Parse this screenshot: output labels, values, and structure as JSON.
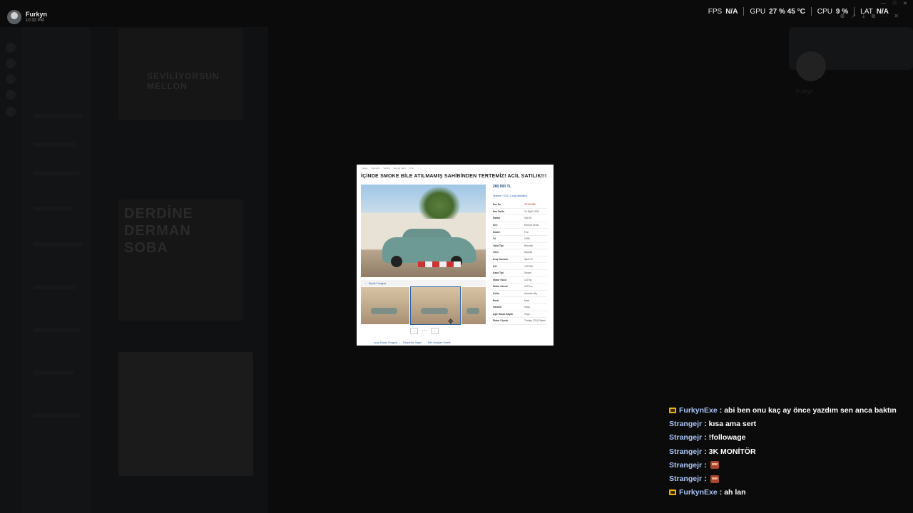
{
  "user": {
    "name": "Furkyn",
    "time": "10:32 PM"
  },
  "overlay": {
    "stats": [
      {
        "label": "FPS",
        "value": "N/A"
      },
      {
        "label": "GPU",
        "value": "27 % 45 °C"
      },
      {
        "label": "CPU",
        "value": "9 %"
      },
      {
        "label": "LAT",
        "value": "N/A"
      }
    ]
  },
  "background": {
    "poster1_text": "SEVİLİYORSUN MELLON",
    "poster2_text": "DERDİNE DERMAN SOBA",
    "right_user": "Furkyn"
  },
  "listing": {
    "breadcrumbs": [
      "Vasıta",
      "Otomobil",
      "VALVE",
      "Eternal Serisi",
      "Fire"
    ],
    "title": "İÇİNDE SMOKE BİLE ATILMAMIŞ SAHİBİNDEN TERTEMİZ! ACİL SATILIK!!!",
    "price": "280.000 TL",
    "location": "Dreamr / CS2 / Long Mahallesi",
    "gallery_label": "Büyük Fotoğraf",
    "specs": [
      {
        "k": "İlan No",
        "v": "SF123456"
      },
      {
        "k": "İlan Tarihi",
        "v": "24 Eylül 2025"
      },
      {
        "k": "Marka",
        "v": "VALVE"
      },
      {
        "k": "Seri",
        "v": "Eternal Serisi"
      },
      {
        "k": "Model",
        "v": "Fire"
      },
      {
        "k": "Yıl",
        "v": "1998"
      },
      {
        "k": "Yakıt Tipi",
        "v": "Benzinli"
      },
      {
        "k": "Vites",
        "v": "Manuel"
      },
      {
        "k": "Araç Durumu",
        "v": "İkinci El"
      },
      {
        "k": "KM",
        "v": "130.000"
      },
      {
        "k": "Kasa Tipi",
        "v": "Sedan"
      },
      {
        "k": "Motor Gücü",
        "v": "120 hp"
      },
      {
        "k": "Motor Hacmi",
        "v": "1679 cc"
      },
      {
        "k": "Çekiş",
        "v": "Arkadan İtiş"
      },
      {
        "k": "Renk",
        "v": "Mavi"
      },
      {
        "k": "Garanti",
        "v": "Hayır"
      },
      {
        "k": "Ağır Hasar Kayıtlı",
        "v": "Hayır"
      },
      {
        "k": "Plaka / Uyruk",
        "v": "Türkiye (TR) Plakalı"
      }
    ],
    "actions": [
      "Araç Hasar Sorgula",
      "Ekspertiz Yaptır",
      "Sıfır Araçları İncele"
    ]
  },
  "chat": [
    {
      "nick": "FurkynExe",
      "badge": true,
      "text": "abi ben onu kaç ay önce yazdım sen anca baktın",
      "emote": false
    },
    {
      "nick": "Strangejr",
      "badge": false,
      "text": "kısa ama sert",
      "emote": false
    },
    {
      "nick": "Strangejr",
      "badge": false,
      "text": "!followage",
      "emote": false
    },
    {
      "nick": "Strangejr",
      "badge": false,
      "text": "3K MONİTÖR",
      "emote": false
    },
    {
      "nick": "Strangejr",
      "badge": false,
      "text": "",
      "emote": true
    },
    {
      "nick": "Strangejr",
      "badge": false,
      "text": "",
      "emote": true
    },
    {
      "nick": "FurkynExe",
      "badge": true,
      "text": "ah lan",
      "emote": false
    }
  ]
}
